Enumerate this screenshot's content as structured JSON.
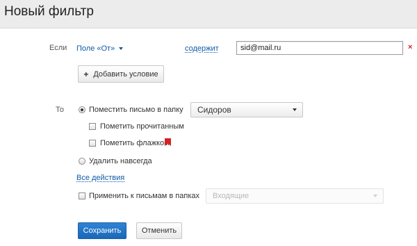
{
  "header": {
    "title": "Новый фильтр"
  },
  "condition": {
    "label": "Если",
    "field_selector": "Поле «От»",
    "operator": "содержит",
    "value": "sid@mail.ru",
    "remove_symbol": "×",
    "add_condition_label": "Добавить условие",
    "add_icon": "+"
  },
  "actions": {
    "label": "То",
    "move_to_folder": {
      "label": "Поместить письмо в папку",
      "checked": true
    },
    "folder_select": {
      "value": "Сидоров"
    },
    "mark_read": {
      "label": "Пометить прочитанным",
      "checked": false
    },
    "mark_flag": {
      "label": "Пометить флажком",
      "checked": false,
      "icon": "flag-icon",
      "icon_color": "#d42121"
    },
    "delete_forever": {
      "label": "Удалить навсегда",
      "checked": false
    },
    "all_actions_link": "Все действия"
  },
  "apply": {
    "label": "Применить к письмам в папках",
    "checked": false,
    "folder_select": {
      "value": "Входящие",
      "disabled": true
    }
  },
  "footer": {
    "save_label": "Сохранить",
    "cancel_label": "Отменить"
  },
  "colors": {
    "link": "#0f5ba8",
    "primary_button": "#1b67b8",
    "remove": "#d61f1f",
    "header_bg": "#ececec"
  }
}
